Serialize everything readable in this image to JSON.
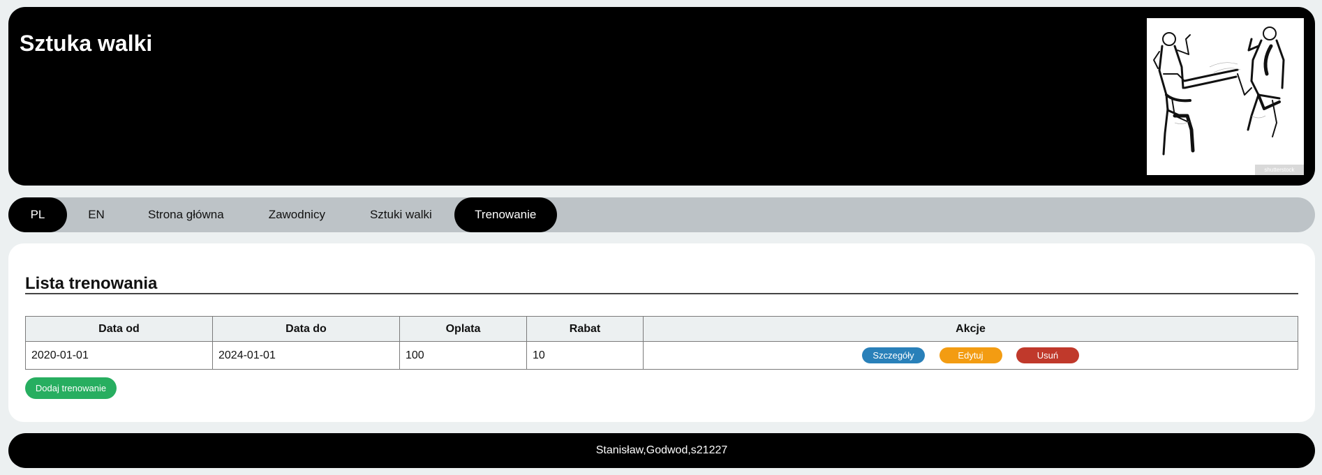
{
  "header": {
    "title": "Sztuka walki",
    "image_watermark": "shutterstock"
  },
  "nav": {
    "items": [
      {
        "label": "PL",
        "active": true
      },
      {
        "label": "EN",
        "active": false
      },
      {
        "label": "Strona główna",
        "active": false
      },
      {
        "label": "Zawodnicy",
        "active": false
      },
      {
        "label": "Sztuki walki",
        "active": false
      },
      {
        "label": "Trenowanie",
        "active": true
      }
    ]
  },
  "main": {
    "title": "Lista trenowania",
    "table": {
      "columns": [
        "Data od",
        "Data do",
        "Oplata",
        "Rabat",
        "Akcje"
      ],
      "rows": [
        {
          "date_from": "2020-01-01",
          "date_to": "2024-01-01",
          "fee": "100",
          "discount": "10"
        }
      ]
    },
    "actions": {
      "details": "Szczegóły",
      "edit": "Edytuj",
      "delete": "Usuń"
    },
    "add_button": "Dodaj trenowanie"
  },
  "footer": {
    "text": "Stanisław,Godwod,s21227"
  },
  "colors": {
    "header_bg": "#000000",
    "page_bg": "#ecf0f1",
    "nav_bg": "#bdc3c7",
    "details": "#2980b9",
    "edit": "#f39c12",
    "delete": "#c0392b",
    "add": "#27ae60"
  }
}
